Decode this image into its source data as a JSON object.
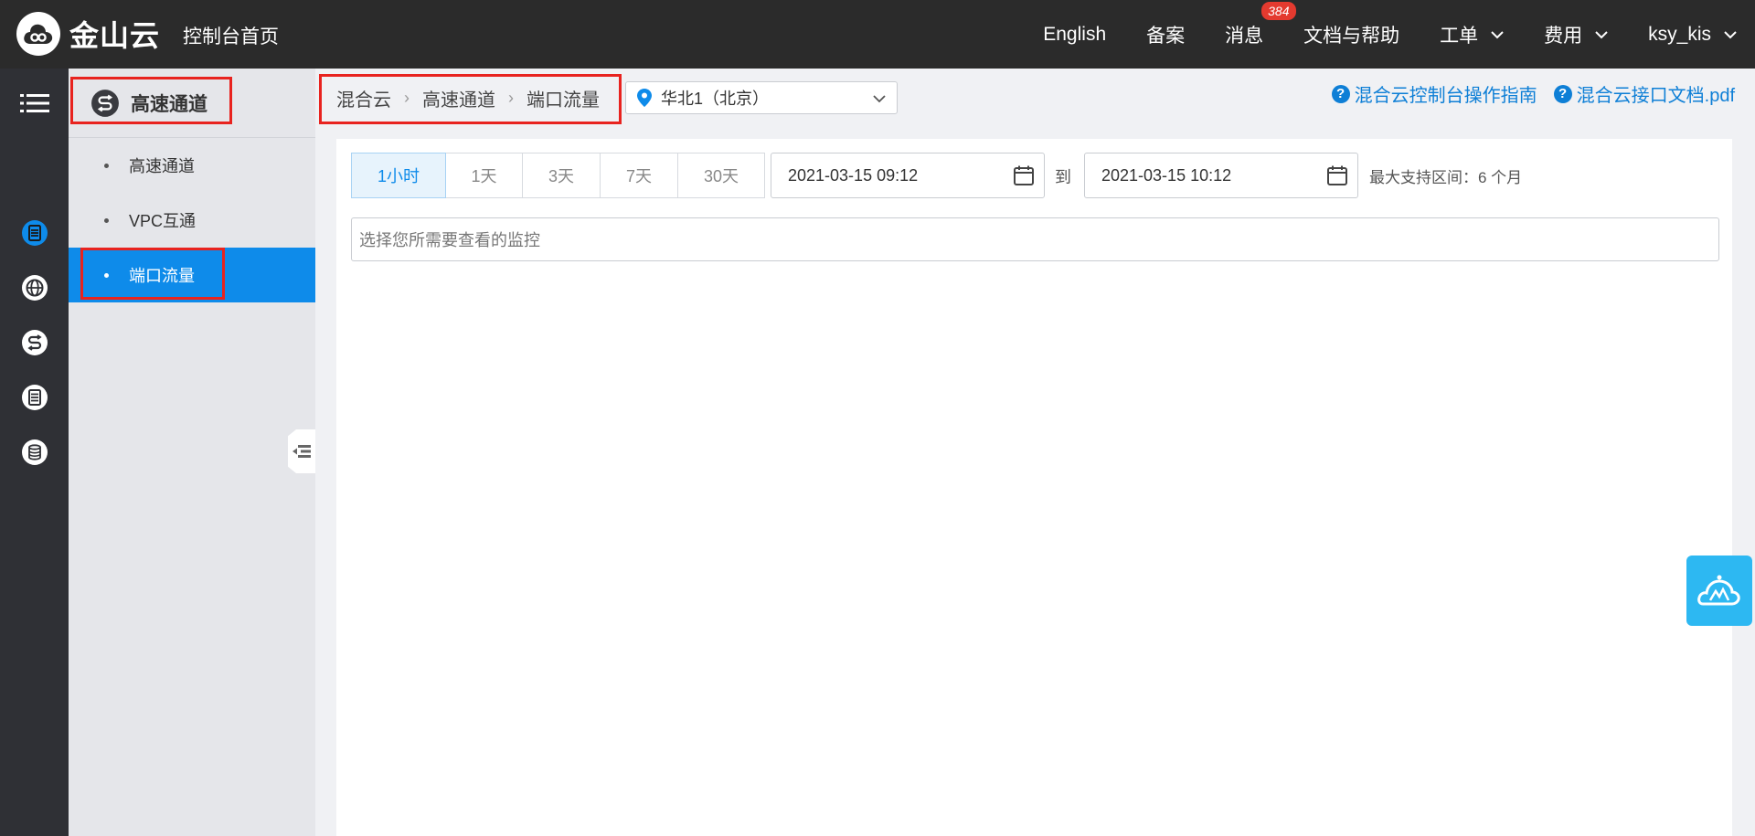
{
  "topbar": {
    "logo_text": "金山云",
    "console_home": "控制台首页",
    "nav": {
      "english": "English",
      "filing": "备案",
      "messages": "消息",
      "messages_badge": "384",
      "docs": "文档与帮助",
      "tickets": "工单",
      "billing": "费用",
      "user": "ksy_kis"
    }
  },
  "rail": {
    "icons": [
      "menu-icon",
      "server-icon",
      "globe-icon",
      "express-channel-icon",
      "storage-icon",
      "database-icon"
    ]
  },
  "sidebar": {
    "title": "高速通道",
    "items": [
      {
        "label": "高速通道",
        "active": false
      },
      {
        "label": "VPC互通",
        "active": false
      },
      {
        "label": "端口流量",
        "active": true
      }
    ]
  },
  "breadcrumb": [
    "混合云",
    "高速通道",
    "端口流量"
  ],
  "region": {
    "selected": "华北1（北京）"
  },
  "help_links": {
    "guide": "混合云控制台操作指南",
    "api_doc": "混合云接口文档.pdf"
  },
  "time_range": {
    "options": [
      "1小时",
      "1天",
      "3天",
      "7天",
      "30天"
    ],
    "selected": "1小时",
    "start": "2021-03-15 09:12",
    "to_label": "到",
    "end": "2021-03-15 10:12",
    "max_note": "最大支持区间：6 个月"
  },
  "monitor_select": {
    "placeholder": "选择您所需要查看的监控"
  },
  "colors": {
    "accent": "#0e8bea",
    "annotation": "#e8231f",
    "topbar": "#2b2b2b"
  }
}
